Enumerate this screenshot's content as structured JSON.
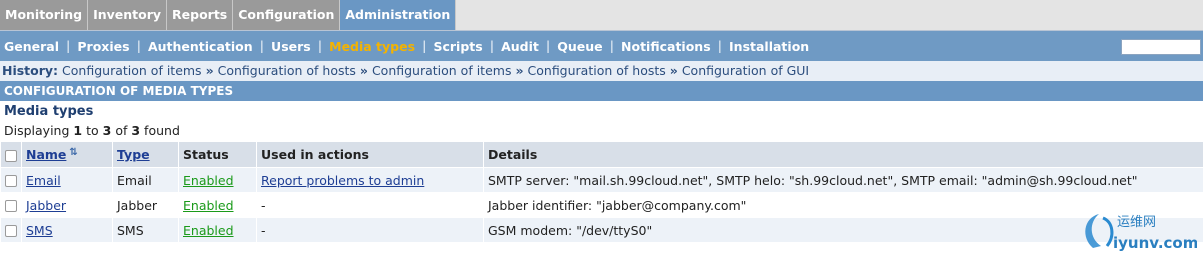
{
  "topnav": {
    "tabs": [
      "Monitoring",
      "Inventory",
      "Reports",
      "Configuration",
      "Administration"
    ]
  },
  "subnav": {
    "items": [
      "General",
      "Proxies",
      "Authentication",
      "Users",
      "Media types",
      "Scripts",
      "Audit",
      "Queue",
      "Notifications",
      "Installation"
    ]
  },
  "history": {
    "label": "History:",
    "items": [
      "Configuration of items",
      "Configuration of hosts",
      "Configuration of items",
      "Configuration of hosts",
      "Configuration of GUI"
    ],
    "separator": "»"
  },
  "page": {
    "title": "CONFIGURATION OF MEDIA TYPES",
    "section_title": "Media types",
    "displaying_prefix": "Displaying",
    "displaying_from": "1",
    "displaying_to_word": "to",
    "displaying_to": "3",
    "displaying_of_word": "of",
    "displaying_total": "3",
    "displaying_suffix": "found"
  },
  "table": {
    "headers": {
      "name": "Name",
      "type": "Type",
      "status": "Status",
      "used": "Used in actions",
      "details": "Details"
    },
    "rows": [
      {
        "name": "Email",
        "type": "Email",
        "status": "Enabled",
        "used": "Report problems to admin",
        "details": "SMTP server: \"mail.sh.99cloud.net\", SMTP helo: \"sh.99cloud.net\", SMTP email: \"admin@sh.99cloud.net\""
      },
      {
        "name": "Jabber",
        "type": "Jabber",
        "status": "Enabled",
        "used": "-",
        "details": "Jabber identifier: \"jabber@company.com\""
      },
      {
        "name": "SMS",
        "type": "SMS",
        "status": "Enabled",
        "used": "-",
        "details": "GSM modem: \"/dev/ttyS0\""
      }
    ]
  },
  "watermark": {
    "cn": "运维网",
    "site": "iyunv.com"
  },
  "colors": {
    "nav_active": "#6a97c4",
    "current_item": "#f4b300",
    "enabled": "#1a9a1a",
    "link": "#1e3e94"
  }
}
